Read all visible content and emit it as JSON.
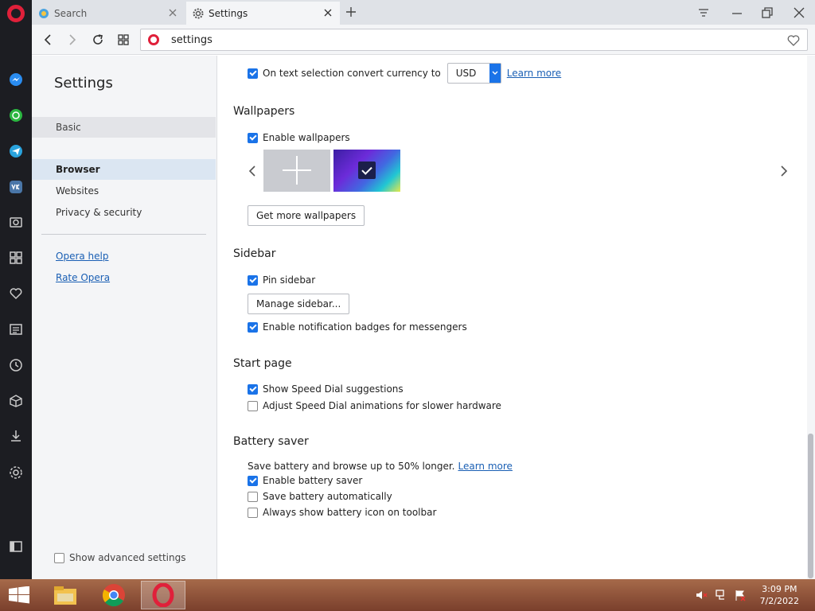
{
  "tabs": [
    {
      "label": "Search"
    },
    {
      "label": "Settings"
    }
  ],
  "address": {
    "url": "settings"
  },
  "nav": {
    "title": "Settings",
    "items": [
      "Basic",
      "Browser",
      "Websites",
      "Privacy & security"
    ],
    "links": [
      "Opera help",
      "Rate Opera"
    ],
    "advanced_label": "Show advanced settings"
  },
  "currency": {
    "label": "On text selection convert currency to",
    "value": "USD",
    "learn_more": "Learn more"
  },
  "wallpapers": {
    "title": "Wallpapers",
    "enable_label": "Enable wallpapers",
    "get_more": "Get more wallpapers"
  },
  "sidebar": {
    "title": "Sidebar",
    "pin_label": "Pin sidebar",
    "manage_button": "Manage sidebar...",
    "badges_label": "Enable notification badges for messengers"
  },
  "start_page": {
    "title": "Start page",
    "speed_dial_label": "Show Speed Dial suggestions",
    "animations_label": "Adjust Speed Dial animations for slower hardware"
  },
  "battery": {
    "title": "Battery saver",
    "description": "Save battery and browse up to 50% longer.",
    "learn_more": "Learn more",
    "enable_label": "Enable battery saver",
    "auto_label": "Save battery automatically",
    "icon_label": "Always show battery icon on toolbar"
  },
  "clock": {
    "time": "3:09 PM",
    "date": "7/2/2022"
  },
  "colors": {
    "accent": "#1a73e8",
    "opera_red": "#e0203a",
    "sidebar_bg": "#1c1d22"
  }
}
